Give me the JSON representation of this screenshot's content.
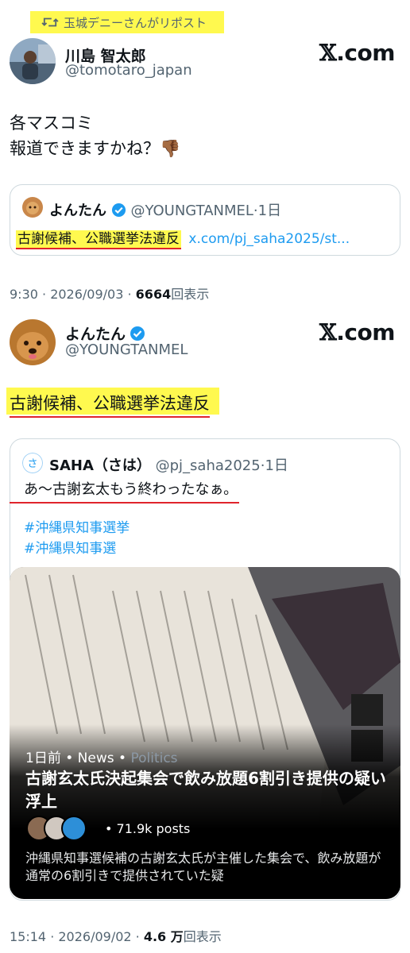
{
  "retweet": {
    "label": "玉城デニーさんがリポスト",
    "icon": "repost-icon"
  },
  "tweet1": {
    "name": "川島 智太郎",
    "handle": "@tomotaro_japan",
    "brand": "com",
    "text_line1": "各マスコミ",
    "text_line2": "報道できますかね？👎🏾",
    "meta_time": "9:30 · 2026/09/03 · ",
    "meta_views": "6664",
    "meta_suffix": "回表示"
  },
  "quote1": {
    "name": "よんたん",
    "handle": "@YOUNGTANMEL",
    "age": "·1日",
    "text": "古謝候補、公職選挙法違反",
    "link": "x.com/pj_saha2025/st..."
  },
  "tweet2": {
    "name": "よんたん",
    "handle": "@YOUNGTANMEL",
    "brand": "com",
    "text": "古謝候補、公職選挙法違反",
    "meta_time": "15:14 · 2026/09/02 · ",
    "meta_views": "4.6 万",
    "meta_suffix": "回表示"
  },
  "quote2": {
    "name": "SAHA（さは）",
    "handle": "@pj_saha2025",
    "age": "·1日",
    "text": "あ〜古謝玄太もう終わったなぁ。",
    "hashtags": [
      "#沖縄県知事選挙",
      "#沖縄県知事選"
    ]
  },
  "news": {
    "age": "1日前",
    "sep": " • ",
    "source": "News",
    "category": "Politics",
    "title": "古謝玄太氏決起集会で飲み放題6割引き提供の疑い浮上",
    "posts": "• 71.9k posts",
    "summary": "沖縄県知事選候補の古謝玄太氏が主催した集会で、飲み放題が通常の6割引きで提供されていた疑"
  },
  "colors": {
    "highlight": "#fff94f",
    "underline": "#e0242c",
    "link": "#1d9bf0",
    "muted": "#536471"
  }
}
